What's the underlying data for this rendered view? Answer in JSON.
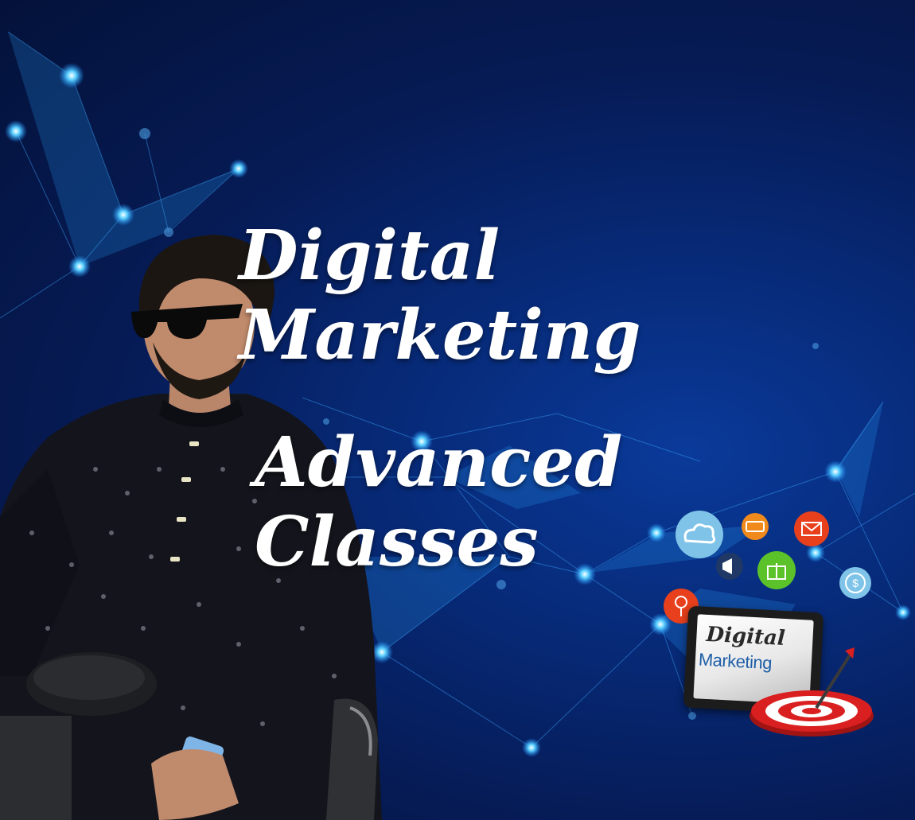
{
  "headline": {
    "line1": "Digital Marketing",
    "line2": "Advanced Classes"
  },
  "graphic": {
    "tablet_word1": "Digital",
    "tablet_word2": "Marketing",
    "icon_names": [
      "cloud-icon",
      "money-icon",
      "mail-icon",
      "megaphone-icon",
      "gift-icon",
      "dollar-icon",
      "search-icon",
      "target-icon"
    ]
  },
  "colors": {
    "background": "#061b55",
    "headline": "#ffffff",
    "network_glow": "#29a6ff",
    "icon_cloud": "#7fc4e8",
    "icon_money": "#f08a1c",
    "icon_mail": "#e8401c",
    "icon_gift": "#5cc229",
    "icon_search": "#e8401c",
    "target_red": "#d91f1f"
  }
}
